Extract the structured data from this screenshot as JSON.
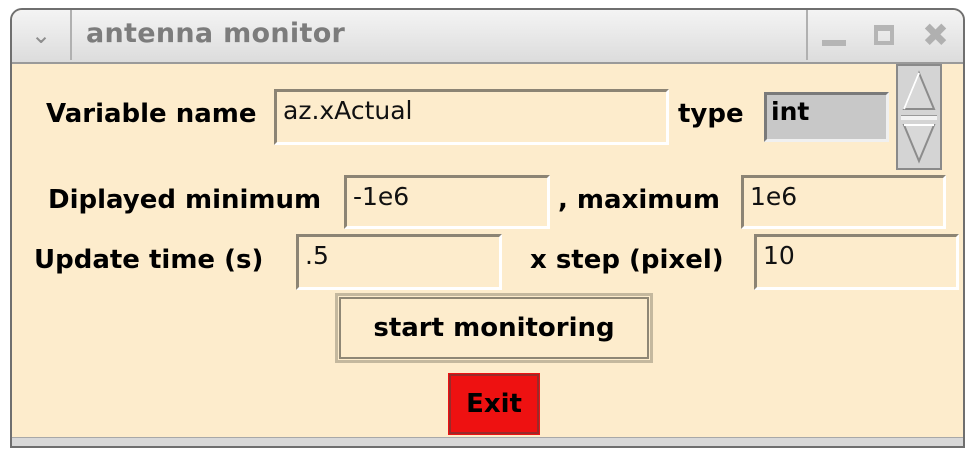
{
  "window": {
    "title": "antenna monitor"
  },
  "form": {
    "variable_name_label": "Variable name",
    "variable_name_value": "az.xActual",
    "type_label": "type",
    "type_value": "int",
    "displayed_min_label": "Diplayed minimum",
    "displayed_min_value": "-1e6",
    "maximum_label": ", maximum",
    "maximum_value": "1e6",
    "update_time_label": "Update time (s)",
    "update_time_value": ".5",
    "x_step_label": "x step (pixel)",
    "x_step_value": "10"
  },
  "buttons": {
    "start_label": "start monitoring",
    "exit_label": "Exit"
  },
  "icons": {
    "menu": "chevron-down-icon",
    "minimize": "minimize-icon",
    "maximize": "maximize-icon",
    "close": "close-icon",
    "spin_up": "triangle-up-icon",
    "spin_down": "triangle-down-icon"
  },
  "colors": {
    "background": "#fdeccc",
    "exit_button": "#ee1111",
    "titlebar": "#e6e6e6"
  }
}
